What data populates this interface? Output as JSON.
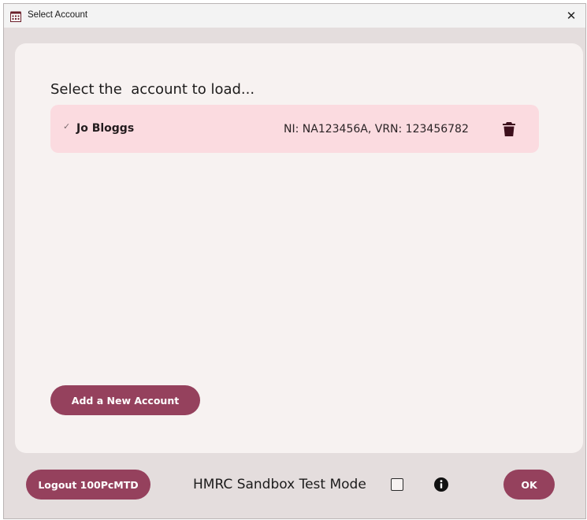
{
  "window": {
    "title": "Select Account",
    "close_glyph": "✕"
  },
  "panel": {
    "heading": "Select the  account to load...",
    "accounts": [
      {
        "check_glyph": "✓",
        "name": "Jo Bloggs",
        "ids": "NI: NA123456A, VRN: 123456782",
        "selected": true,
        "delete_icon": "trash-icon"
      }
    ],
    "add_account_label": "Add a New Account"
  },
  "footer": {
    "logout_label": "Logout 100PcMTD",
    "sandbox_label": "HMRC Sandbox Test Mode",
    "sandbox_checked": false,
    "info_icon": "info-icon",
    "ok_label": "OK"
  },
  "colors": {
    "accent": "#95415d",
    "row_selected": "#fbdbe0",
    "panel_bg": "#f7f2f1",
    "window_bg": "#e4dddd"
  }
}
